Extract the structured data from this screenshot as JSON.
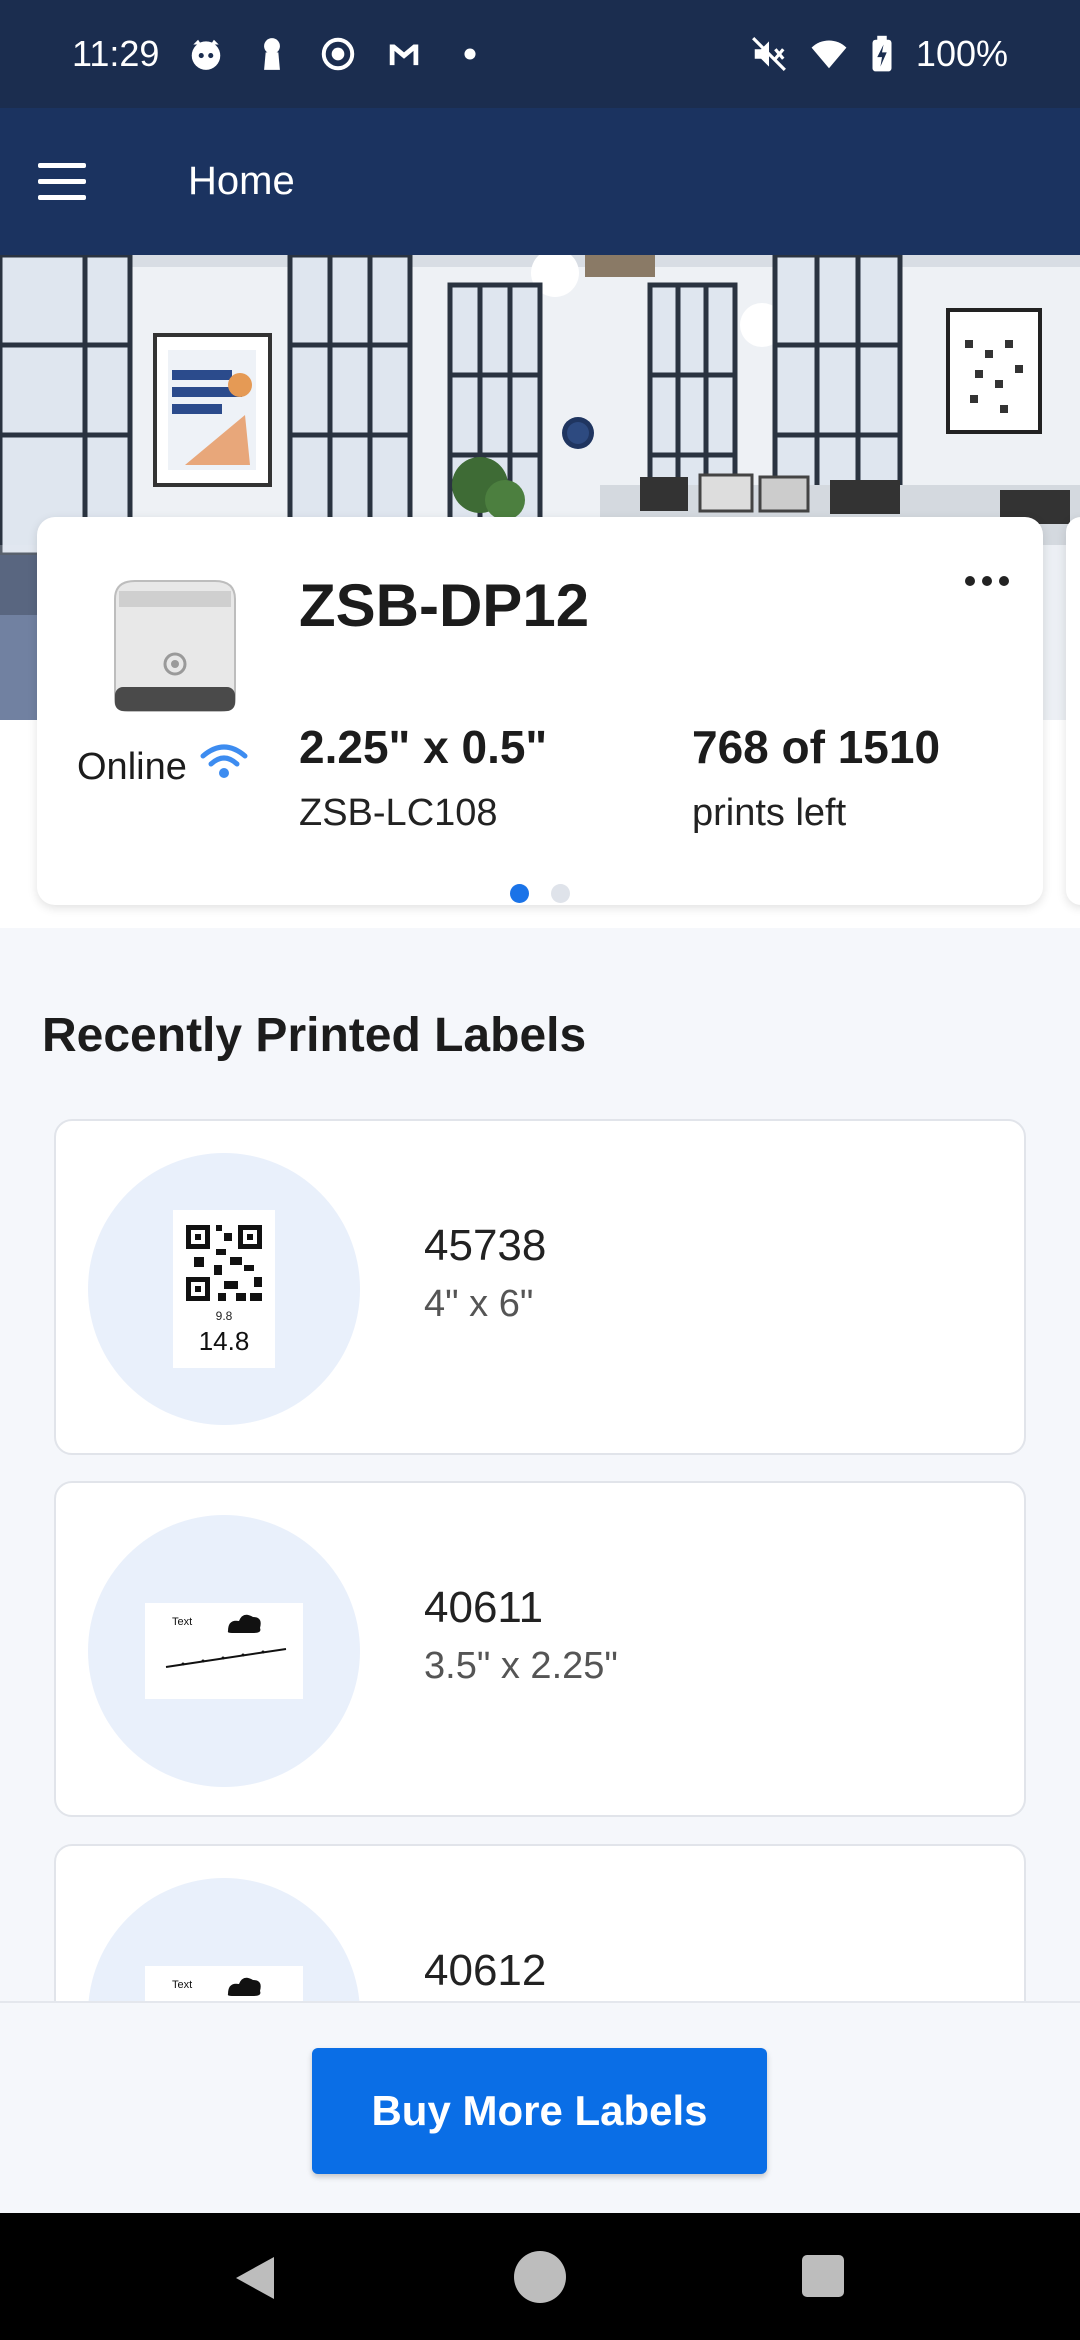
{
  "status_bar": {
    "time": "11:29",
    "battery": "100%",
    "notification_icons": [
      "cat-icon",
      "keyhole-icon",
      "target-icon",
      "gmail-icon",
      "dot-icon"
    ],
    "system_icons": [
      "mute-icon",
      "wifi-icon",
      "battery-charging-icon"
    ]
  },
  "app_bar": {
    "title": "Home",
    "menu_icon": "hamburger-menu-icon"
  },
  "printer": {
    "name": "ZSB-DP12",
    "status": "Online",
    "label_size": "2.25\" x 0.5\"",
    "label_model": "ZSB-LC108",
    "prints_count": "768 of 1510",
    "prints_label": "prints left",
    "carousel_page": 1,
    "carousel_total": 2
  },
  "recent": {
    "title": "Recently Printed Labels",
    "items": [
      {
        "id": "45738",
        "size": "4\" x 6\"",
        "thumb": "qr-label",
        "thumb_small_text": "9.8",
        "thumb_big_text": "14.8"
      },
      {
        "id": "40611",
        "size": "3.5\" x 2.25\"",
        "thumb": "text-cloud-label",
        "thumb_text": "Text"
      },
      {
        "id": "40612",
        "size": "",
        "thumb": "text-cloud-label",
        "thumb_text": "Text"
      }
    ]
  },
  "footer": {
    "buy_button": "Buy More Labels"
  },
  "colors": {
    "status_bar": "#1b2d4f",
    "app_bar": "#1b3360",
    "accent": "#0a6ee6",
    "wifi": "#3d8cf0"
  }
}
